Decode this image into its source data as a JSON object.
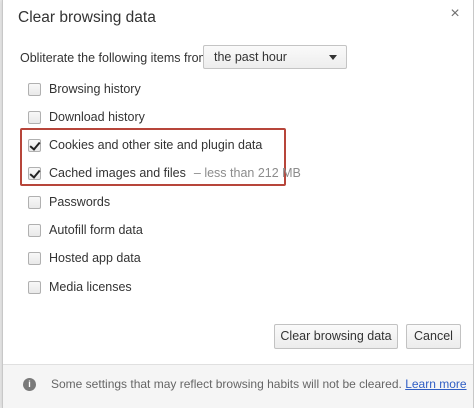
{
  "dialog": {
    "title": "Clear browsing data",
    "close_glyph": "×"
  },
  "range": {
    "label": "Obliterate the following items from:",
    "selected": "the past hour"
  },
  "options": [
    {
      "label": "Browsing history",
      "checked": false
    },
    {
      "label": "Download history",
      "checked": false
    },
    {
      "label": "Cookies and other site and plugin data",
      "checked": true
    },
    {
      "label": "Cached images and files",
      "checked": true,
      "detail": "–  less than 212 MB"
    },
    {
      "label": "Passwords",
      "checked": false
    },
    {
      "label": "Autofill form data",
      "checked": false
    },
    {
      "label": "Hosted app data",
      "checked": false
    },
    {
      "label": "Media licenses",
      "checked": false
    }
  ],
  "buttons": {
    "clear": "Clear browsing data",
    "cancel": "Cancel"
  },
  "footer": {
    "icon_glyph": "i",
    "text": "Some settings that may reflect browsing habits will not be cleared.",
    "link": "Learn more"
  },
  "colors": {
    "highlight_border": "#b7453a",
    "link": "#2f5ec4"
  }
}
